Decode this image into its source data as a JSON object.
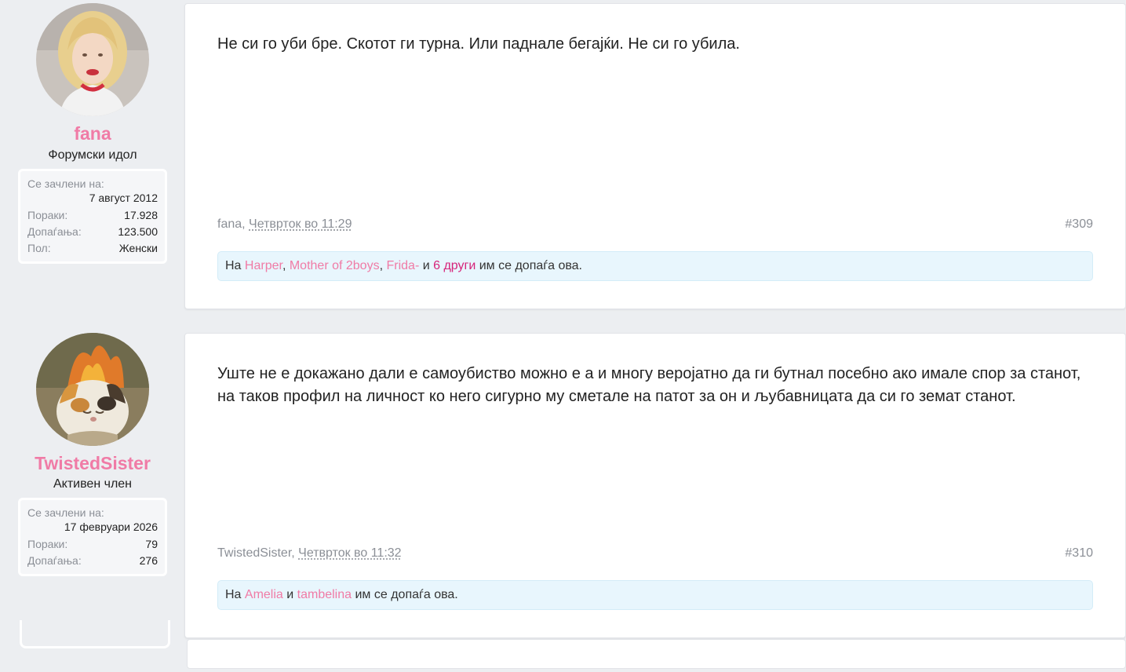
{
  "posts": [
    {
      "author": {
        "username": "fana",
        "title": "Форумски идол",
        "stats": {
          "joined_label": "Се зачлени на:",
          "joined_value": "7 август 2012",
          "rows": [
            {
              "label": "Пораки:",
              "value": "17.928"
            },
            {
              "label": "Допаѓања:",
              "value": "123.500"
            },
            {
              "label": "Пол:",
              "value": "Женски"
            }
          ]
        }
      },
      "text": "Не си го уби бре. Скотот ги турна. Или паднале бегајќи. Не си го убила.",
      "meta_author": "fana,",
      "meta_date": "Четврток во 11:29",
      "post_number": "#309",
      "likes": {
        "prefix": "На",
        "users": [
          "Harper",
          "Mother of 2boys",
          "Frida-"
        ],
        "sep1": ",",
        "sep2": ",",
        "and": "и",
        "more": "6 други",
        "suffix": "им се допаѓа ова."
      }
    },
    {
      "author": {
        "username": "TwistedSister",
        "title": "Активен член",
        "stats": {
          "joined_label": "Се зачлени на:",
          "joined_value": "17 февруари 2026",
          "rows": [
            {
              "label": "Пораки:",
              "value": "79"
            },
            {
              "label": "Допаѓања:",
              "value": "276"
            }
          ]
        }
      },
      "text": "Уште не е докажано дали е самоубиство можно е а и многу веројатно да ги бутнал посебно ако имале спор за станот, на таков профил на личност ко него сигурно му сметале на патот за он и љубавницата да си го земат станот.",
      "meta_author": "TwistedSister,",
      "meta_date": "Четврток во 11:32",
      "post_number": "#310",
      "likes": {
        "prefix": "На",
        "users": [
          "Amelia",
          "tambelina"
        ],
        "and": "и",
        "suffix": "им се допаѓа ова."
      }
    }
  ],
  "colors": {
    "username": "#f07ba6",
    "like_user": "#f07ba6",
    "like_more": "#d6247a",
    "likes_bg": "#e8f6fd",
    "page_bg": "#eceef1"
  }
}
